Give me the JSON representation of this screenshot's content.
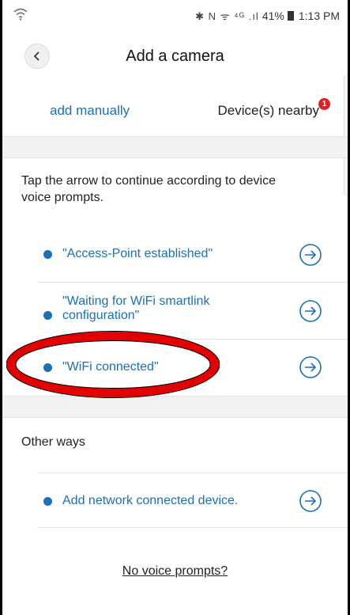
{
  "status_bar": {
    "icons_text": "✱ N ᯤ ⁴ᴳ .ıl",
    "battery_text": "41%",
    "time": "1:13 PM"
  },
  "header": {
    "title": "Add a camera"
  },
  "tabs": {
    "add_manually": "add manually",
    "devices_nearby": "Device(s) nearby",
    "nearby_badge": "1"
  },
  "instructions": "Tap the arrow to continue according to device voice prompts.",
  "steps": [
    {
      "label": "\"Access-Point established\""
    },
    {
      "label": "\"Waiting for WiFi smartlink configuration\""
    },
    {
      "label": "\"WiFi connected\""
    }
  ],
  "other_ways": {
    "heading": "Other ways",
    "items": [
      {
        "label": "Add network connected device."
      }
    ]
  },
  "footer": {
    "no_voice_link": "No voice prompts?"
  },
  "colors": {
    "accent": "#1a6fb8",
    "badge": "#e02020",
    "annotation": "#e30000"
  }
}
